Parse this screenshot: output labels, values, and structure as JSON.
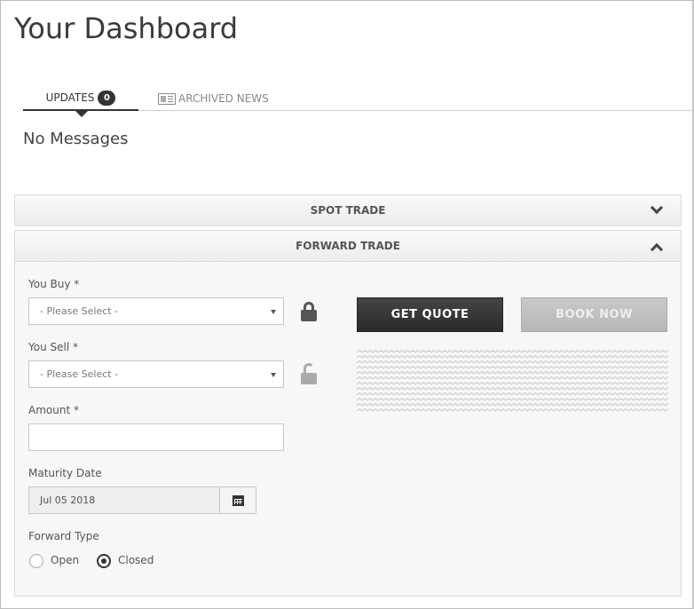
{
  "page": {
    "title": "Your Dashboard"
  },
  "tabs": {
    "updates_label": "UPDATES",
    "updates_count": "0",
    "archived_label": "ARCHIVED NEWS"
  },
  "messages": {
    "empty_text": "No Messages"
  },
  "accordion": {
    "spot_trade": "SPOT TRADE",
    "forward_trade": "FORWARD TRADE"
  },
  "form": {
    "you_buy_label": "You Buy *",
    "you_buy_value": "- Please Select -",
    "you_sell_label": "You Sell *",
    "you_sell_value": "- Please Select -",
    "amount_label": "Amount *",
    "amount_value": "",
    "maturity_label": "Maturity Date",
    "maturity_value": "Jul 05 2018",
    "forward_type_label": "Forward Type",
    "forward_type_options": [
      "Open",
      "Closed"
    ],
    "forward_type_selected": "Closed"
  },
  "actions": {
    "get_quote": "GET QUOTE",
    "book_now": "BOOK NOW"
  },
  "icons": {
    "news": "newspaper-icon",
    "buy_lock": "lock-closed-icon",
    "sell_lock": "lock-open-icon",
    "calendar": "calendar-icon",
    "spot_chevron": "chevron-down-icon",
    "forward_chevron": "chevron-up-icon"
  },
  "colors": {
    "accent": "#333333",
    "disabled_button": "#bdbdbd",
    "panel_bg": "#f7f7f7"
  }
}
